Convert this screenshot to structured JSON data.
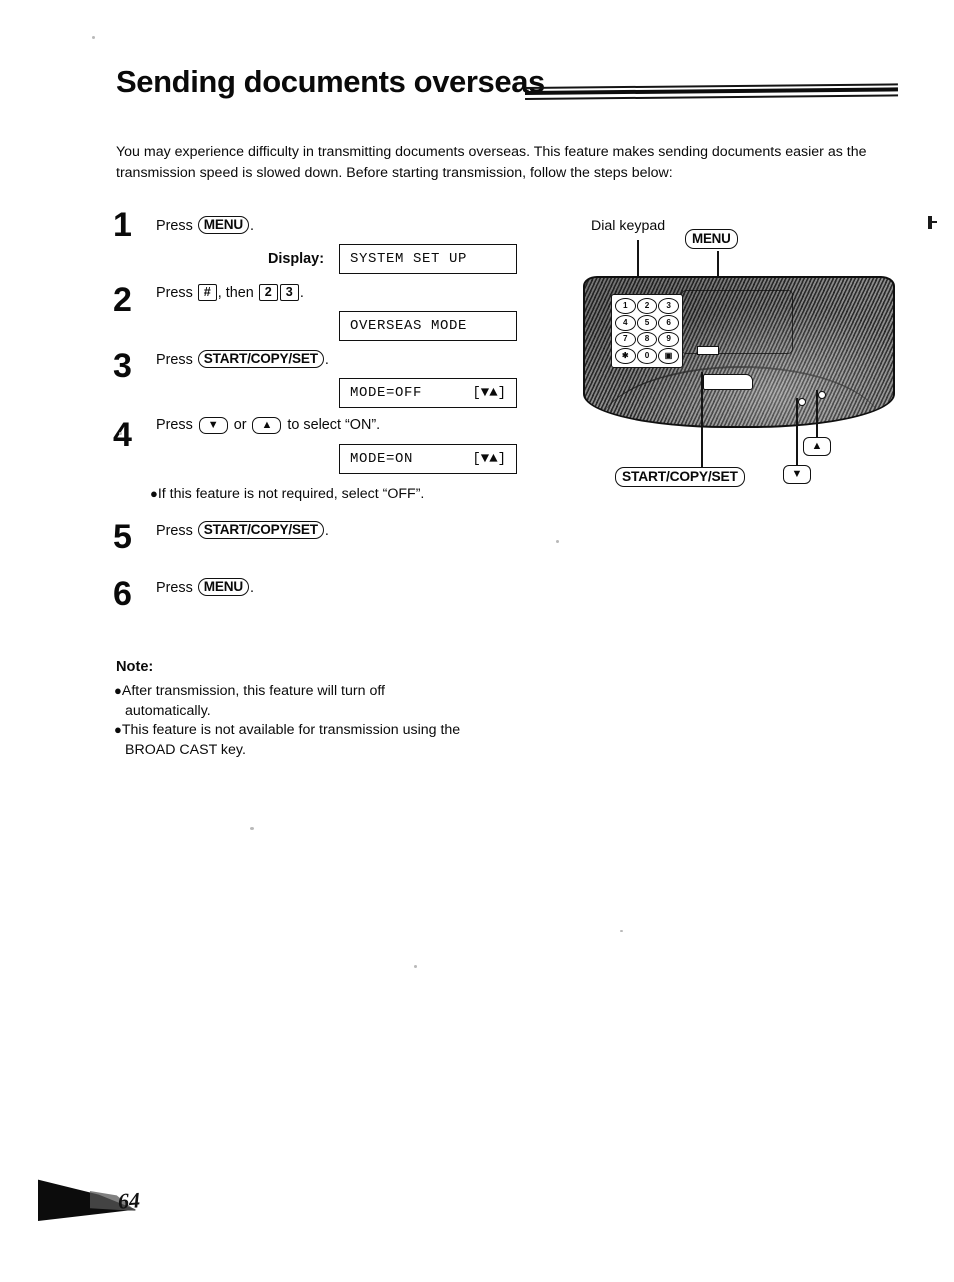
{
  "page": {
    "title": "Sending documents overseas",
    "page_number": "64",
    "intro": "You may experience difficulty in transmitting documents overseas. This feature makes sending documents easier as the transmission speed is slowed down. Before starting transmission, follow the steps below:"
  },
  "steps": [
    {
      "number": "1",
      "press_word": "Press",
      "key": "MENU",
      "period": ".",
      "display_label": "Display:",
      "display_text": "SYSTEM SET UP",
      "display_right": ""
    },
    {
      "number": "2",
      "press_word": "Press",
      "key_hash": "#",
      "then_word": ", then",
      "key_2": "2",
      "key_3": "3",
      "period": ".",
      "display_text": "OVERSEAS MODE",
      "display_right": ""
    },
    {
      "number": "3",
      "press_word": "Press",
      "key": "START/COPY/SET",
      "period": ".",
      "display_text": "MODE=OFF",
      "display_right": "[▼▲]"
    },
    {
      "number": "4",
      "press_word": "Press",
      "key_down": "▼",
      "or_word": "or",
      "key_up": "▲",
      "tail_word": "to select “ON”.",
      "display_text": "MODE=ON",
      "display_right": "[▼▲]",
      "bullet": "If this feature is not required, select “OFF”."
    },
    {
      "number": "5",
      "press_word": "Press",
      "key": "START/COPY/SET",
      "period": "."
    },
    {
      "number": "6",
      "press_word": "Press",
      "key": "MENU",
      "period": "."
    }
  ],
  "note": {
    "heading": "Note:",
    "items": [
      {
        "line1": "After transmission, this feature will turn off",
        "line2": "automatically."
      },
      {
        "line1": "This feature is not available for transmission using the",
        "line2": "BROAD CAST key."
      }
    ]
  },
  "diagram": {
    "callouts": {
      "dial_keypad": "Dial keypad",
      "menu": "MENU",
      "start_copy_set": "START/COPY/SET",
      "arrow_up": "▲",
      "arrow_down": "▼"
    },
    "keypad_keys": [
      "1",
      "2",
      "3",
      "4",
      "5",
      "6",
      "7",
      "8",
      "9",
      "✱",
      "0",
      "▣"
    ]
  }
}
